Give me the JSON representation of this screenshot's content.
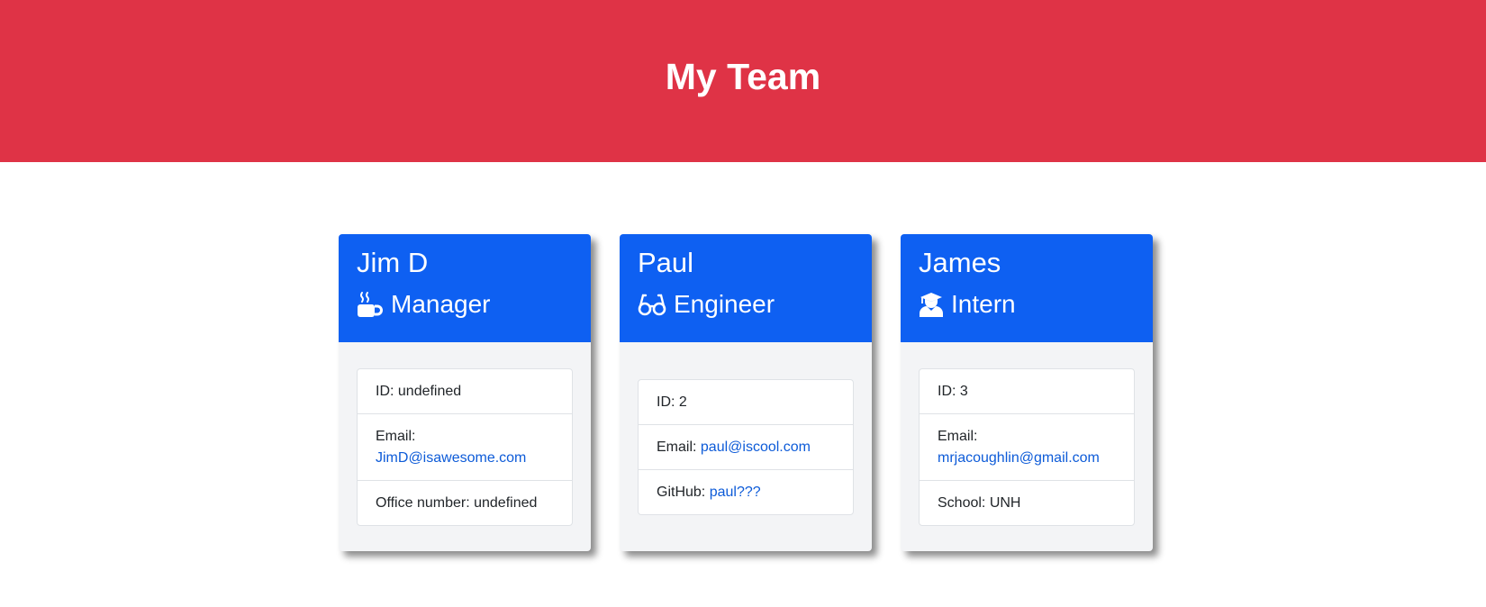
{
  "header": {
    "title": "My Team"
  },
  "colors": {
    "header_bg": "#df3346",
    "card_head_bg": "#0e60f2",
    "link": "#0d5bd8"
  },
  "cards": [
    {
      "name": "Jim D",
      "role": "Manager",
      "role_icon": "mug-hot-icon",
      "id_label": "ID: ",
      "id_value": "undefined",
      "email_label": "Email:",
      "email_value": "JimD@isawesome.com",
      "extra_label": "Office number: ",
      "extra_value": "undefined"
    },
    {
      "name": "Paul",
      "role": "Engineer",
      "role_icon": "glasses-icon",
      "id_label": "ID: ",
      "id_value": "2",
      "email_label": "Email: ",
      "email_value": "paul@iscool.com",
      "extra_label": "GitHub: ",
      "extra_value": "paul???"
    },
    {
      "name": "James",
      "role": "Intern",
      "role_icon": "graduate-icon",
      "id_label": "ID: ",
      "id_value": "3",
      "email_label": "Email:",
      "email_value": "mrjacoughlin@gmail.com",
      "extra_label": "School: ",
      "extra_value": "UNH"
    }
  ]
}
